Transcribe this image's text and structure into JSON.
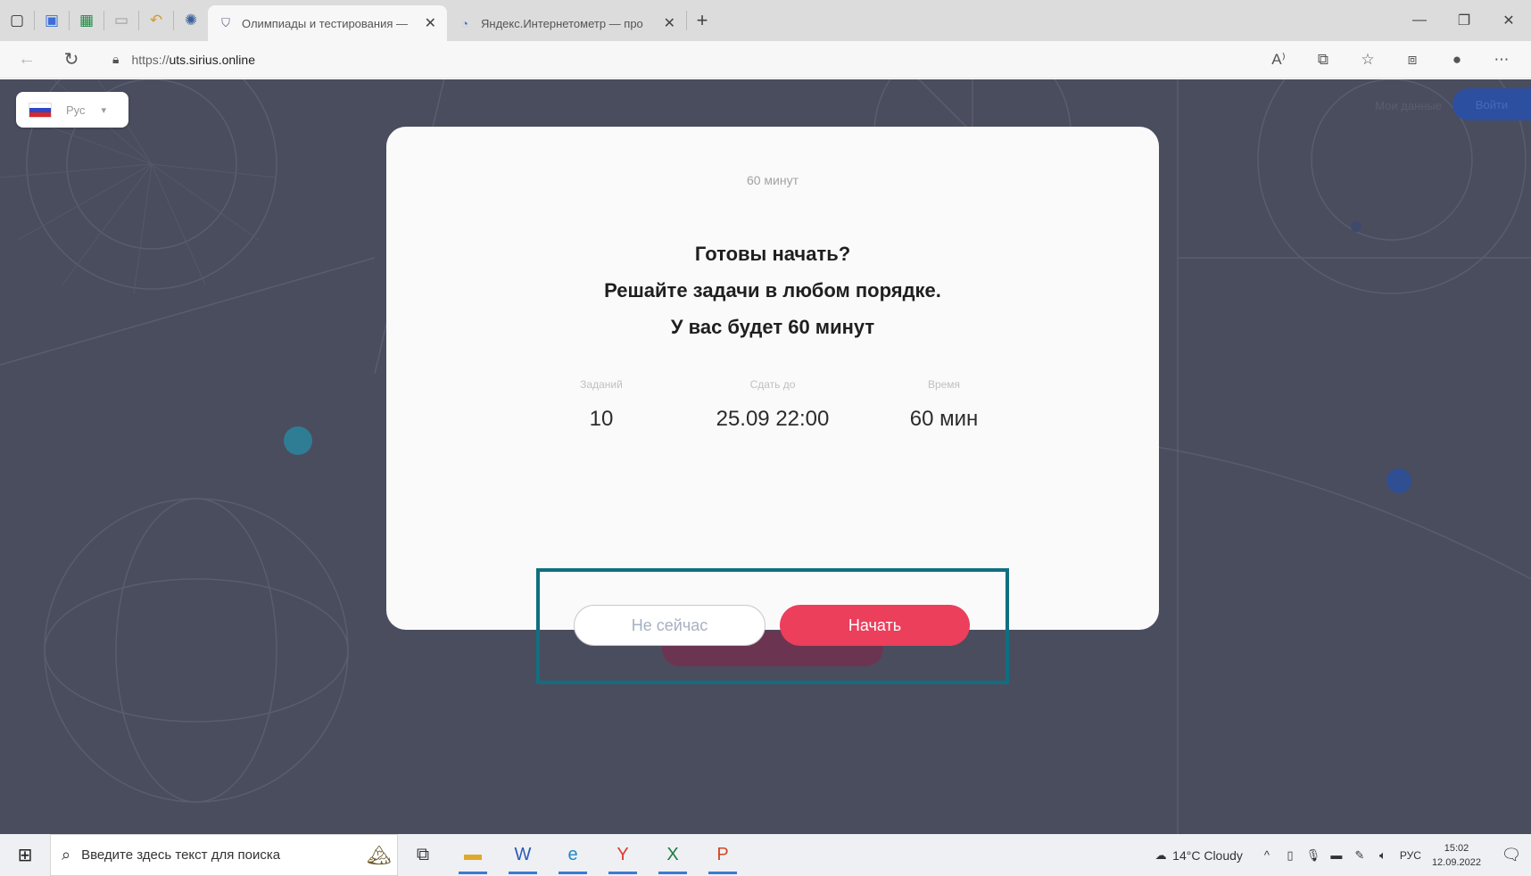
{
  "browser": {
    "tabs": [
      {
        "title": "Олимпиады и тестирования —",
        "active": true
      },
      {
        "title": "Яндекс.Интернетометр — про",
        "active": false
      }
    ],
    "url_prefix": "https://",
    "url_host": "uts.sirius.online"
  },
  "page": {
    "lang_label": "Рус",
    "header_link": "Мои данные",
    "header_button": "Войти"
  },
  "modal": {
    "duration": "60 минут",
    "heading_line1": "Готовы начать?",
    "heading_line2": "Решайте задачи в любом порядке.",
    "heading_line3": "У вас будет 60 минут",
    "stats": [
      {
        "label": "Заданий",
        "value": "10"
      },
      {
        "label": "Сдать до",
        "value": "25.09 22:00"
      },
      {
        "label": "Время",
        "value": "60 мин"
      }
    ],
    "later_button": "Не сейчас",
    "start_button": "Начать"
  },
  "taskbar": {
    "search_placeholder": "Введите здесь текст для поиска",
    "weather": "14°C  Cloudy",
    "lang": "РУС",
    "time": "15:02",
    "date": "12.09.2022"
  },
  "colors": {
    "overlay": "#4a4d5e",
    "accent_red": "#eb3f5c",
    "highlight_teal": "#0f6f80"
  }
}
